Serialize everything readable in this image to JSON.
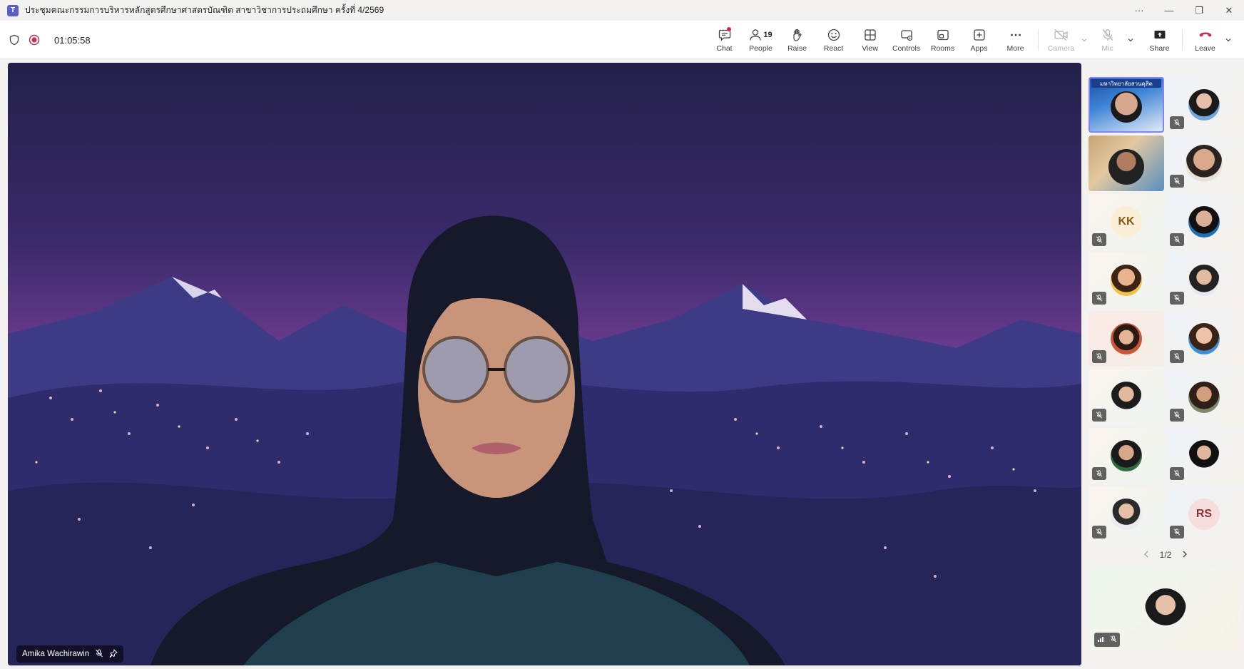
{
  "window": {
    "app_logo": "T",
    "title": "ประชุมคณะกรรมการบริหารหลักสูตรศึกษาศาสตรบัณฑิต สาขาวิชาการประถมศึกษา ครั้งที่ 4/2569",
    "controls": {
      "more": "···",
      "minimize": "—",
      "restore": "❐",
      "close": "✕"
    }
  },
  "toolbar": {
    "timer": "01:05:58",
    "chat_label": "Chat",
    "people_label": "People",
    "people_count": "19",
    "raise_label": "Raise",
    "react_label": "React",
    "view_label": "View",
    "controls_label": "Controls",
    "rooms_label": "Rooms",
    "apps_label": "Apps",
    "more_label": "More",
    "camera_label": "Camera",
    "mic_label": "Mic",
    "share_label": "Share",
    "leave_label": "Leave"
  },
  "main_video": {
    "speaker_name": "Amika Wachirawin"
  },
  "participants": {
    "tiles": [
      {
        "type": "video",
        "active": true,
        "banner_text": "มหาวิทยาลัยสวนดุสิต"
      },
      {
        "type": "photo",
        "muted": true
      },
      {
        "type": "video"
      },
      {
        "type": "photo",
        "muted": true
      },
      {
        "type": "initials",
        "initials": "KK",
        "muted": true
      },
      {
        "type": "photo",
        "muted": true
      },
      {
        "type": "photo",
        "muted": true
      },
      {
        "type": "photo",
        "muted": true
      },
      {
        "type": "photo",
        "muted": true
      },
      {
        "type": "photo",
        "muted": true
      },
      {
        "type": "photo",
        "muted": true
      },
      {
        "type": "photo",
        "muted": true
      },
      {
        "type": "photo",
        "muted": true
      },
      {
        "type": "photo",
        "muted": true
      },
      {
        "type": "photo",
        "muted": true
      },
      {
        "type": "initials",
        "initials": "RS",
        "muted": true
      }
    ],
    "page_indicator": "1/2"
  },
  "colors": {
    "accent": "#5b5fc7",
    "record": "#c4314b",
    "leave": "#c4314b",
    "active_outline": "#7f85f5"
  }
}
